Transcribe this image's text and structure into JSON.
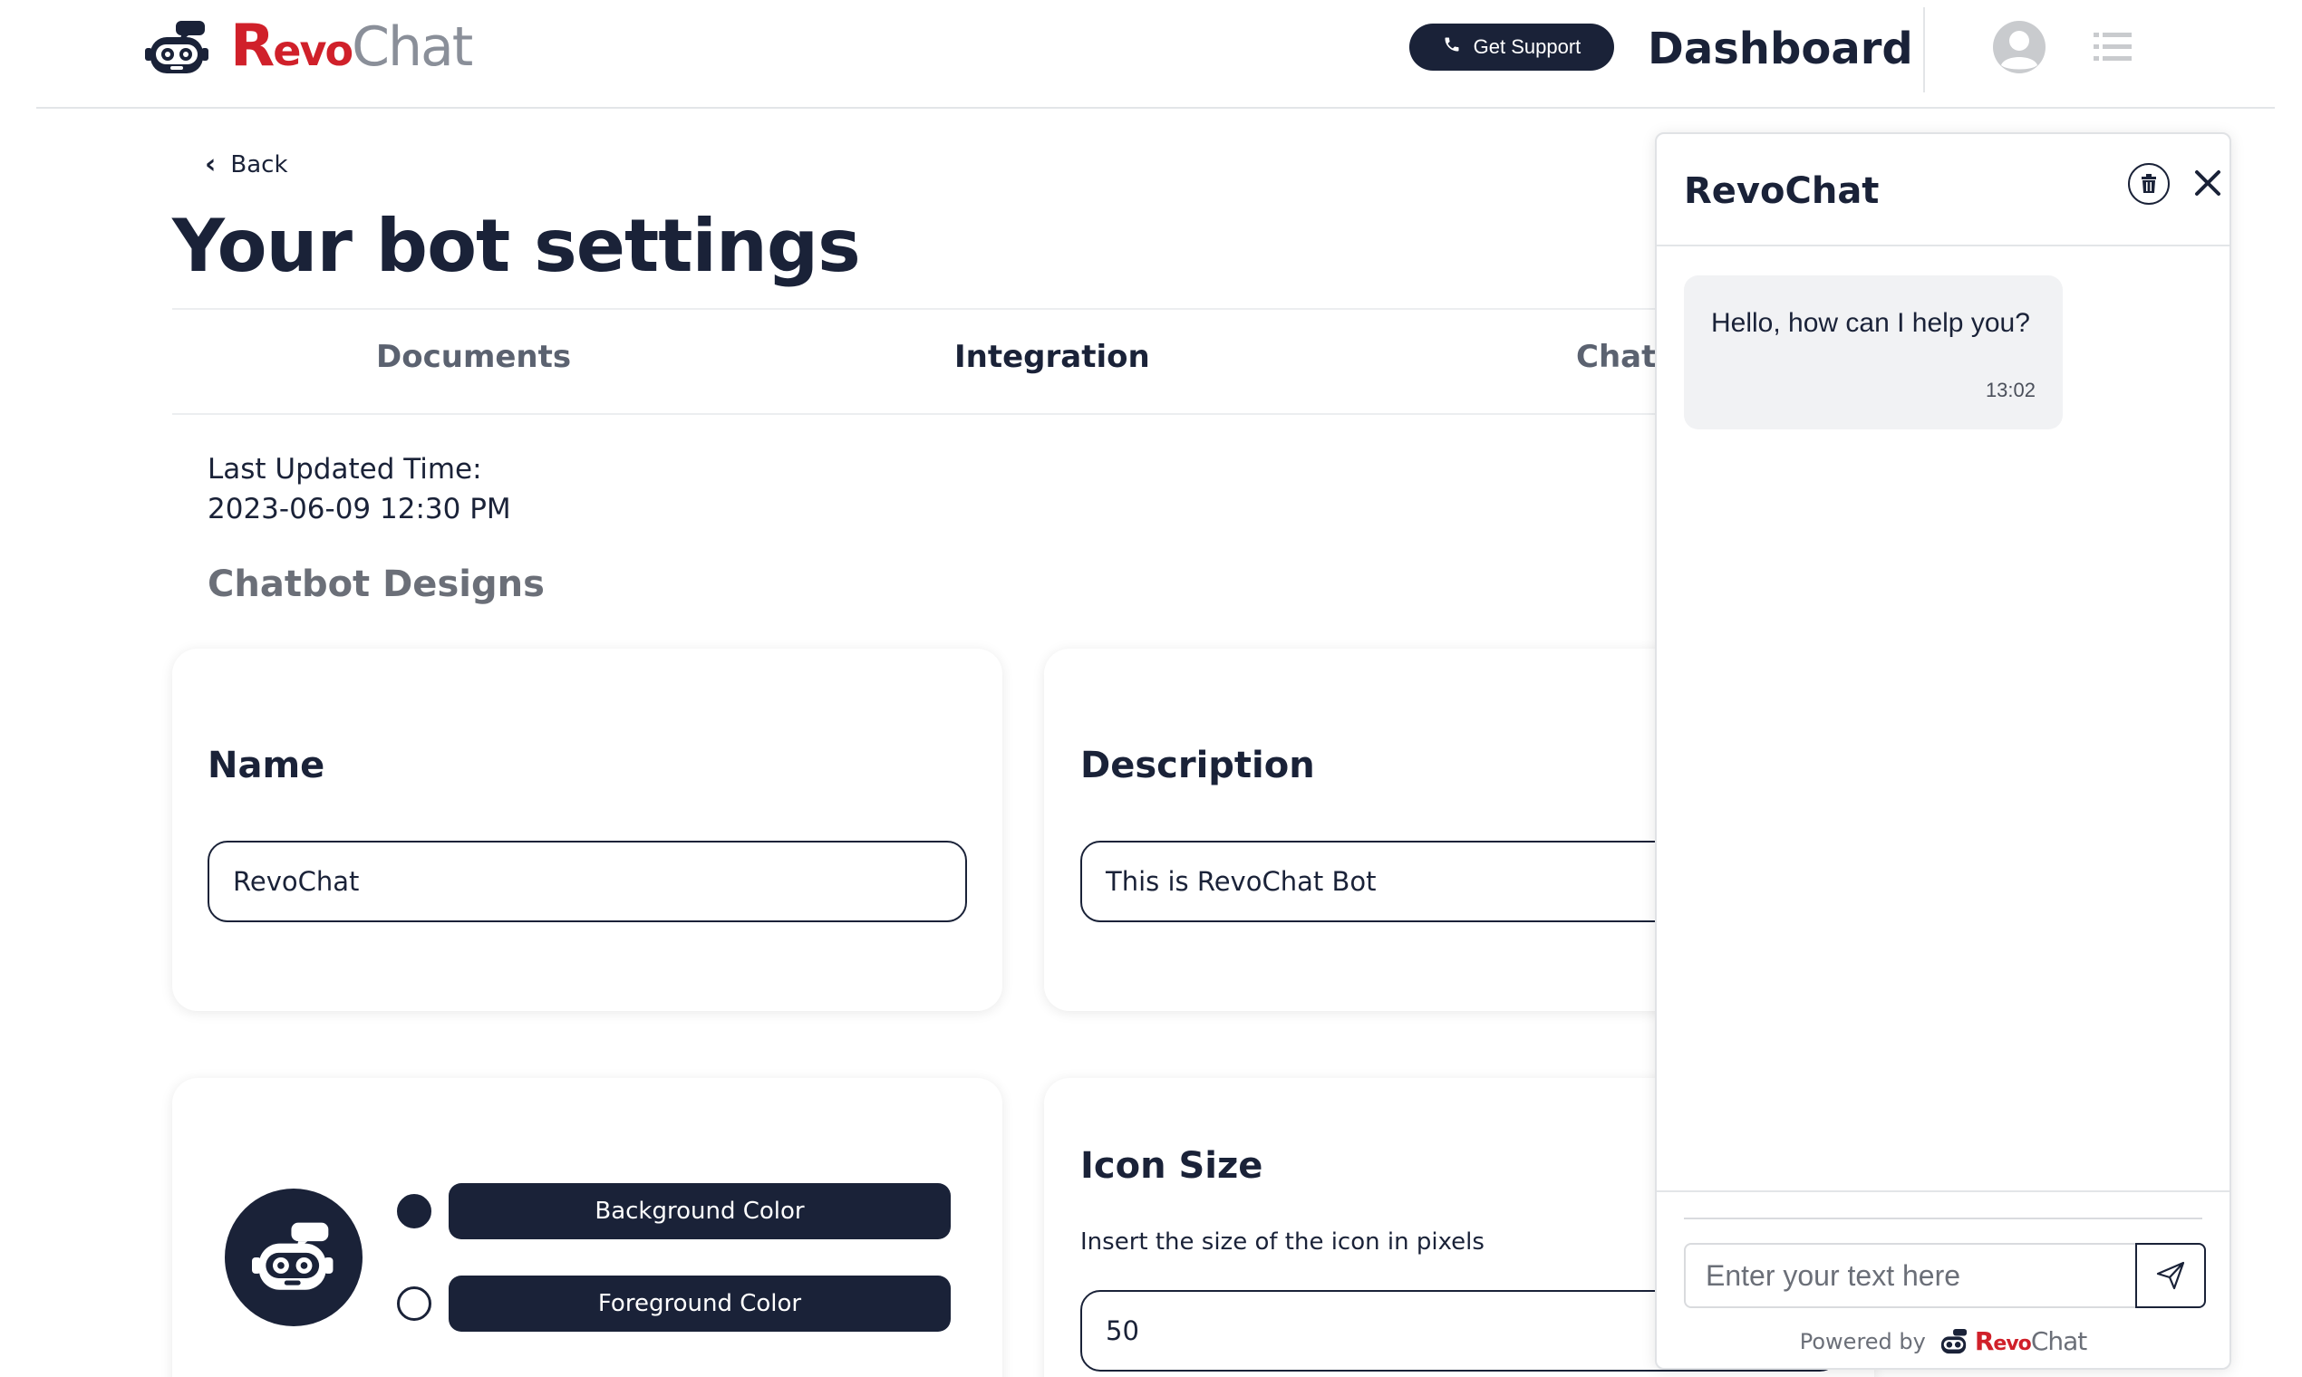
{
  "header": {
    "logo": {
      "r": "R",
      "evo": "evo",
      "chat": "Chat"
    },
    "support_label": "Get Support",
    "title": "Dashboard",
    "icons": {
      "logo": "robot-icon",
      "support": "phone-icon",
      "avatar": "user-avatar-icon",
      "menu": "list-menu-icon"
    }
  },
  "page": {
    "back_label": "Back",
    "title": "Your bot settings",
    "tabs": [
      {
        "label": "Documents"
      },
      {
        "label": "Integration",
        "active": true
      },
      {
        "label": "Chats"
      }
    ],
    "last_updated_label": "Last Updated Time:",
    "last_updated_value": "2023-06-09 12:30 PM",
    "section_title": "Chatbot Designs"
  },
  "name_card": {
    "title": "Name",
    "value": "RevoChat"
  },
  "description_card": {
    "title": "Description",
    "value": "This is RevoChat Bot"
  },
  "color_card": {
    "background_label": "Background Color",
    "foreground_label": "Foreground Color",
    "background_color": "#1a2238",
    "foreground_color": "#ffffff"
  },
  "icon_size_card": {
    "title": "Icon Size",
    "helper": "Insert the size of the icon in pixels",
    "value": "50"
  },
  "chat": {
    "title": "RevoChat",
    "messages": [
      {
        "text": "Hello, how can I help you?",
        "time": "13:02"
      }
    ],
    "input_placeholder": "Enter your text here",
    "powered_by": "Powered by",
    "brand": {
      "r": "R",
      "evo": "evo",
      "chat": "Chat"
    }
  },
  "colors": {
    "primary": "#1a2238",
    "brand_red": "#d0202a",
    "muted": "#8a8f99"
  }
}
